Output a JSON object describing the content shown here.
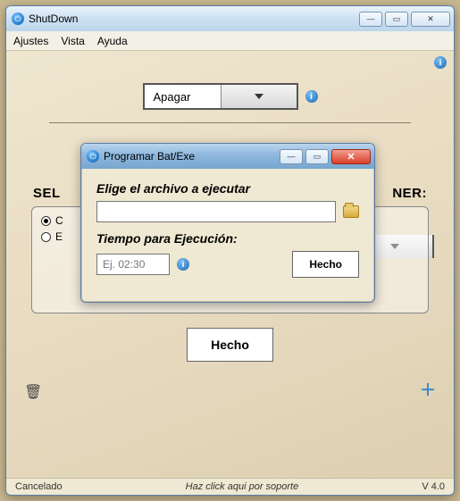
{
  "main": {
    "title": "ShutDown",
    "menu": [
      "Ajustes",
      "Vista",
      "Ayuda"
    ],
    "action_combo": "Apagar",
    "group_label_left": "SEL",
    "group_label_right": "NER:",
    "radios": [
      "C",
      "E"
    ],
    "done_btn": "Hecho"
  },
  "modal": {
    "title": "Programar Bat/Exe",
    "file_label": "Elige el archivo a ejecutar",
    "file_value": "",
    "time_label": "Tiempo para Ejecución:",
    "time_placeholder": "Ej. 02:30",
    "done_btn": "Hecho"
  },
  "status": {
    "left": "Cancelado",
    "mid": "Haz click aqui por soporte",
    "right": "V 4.0"
  }
}
